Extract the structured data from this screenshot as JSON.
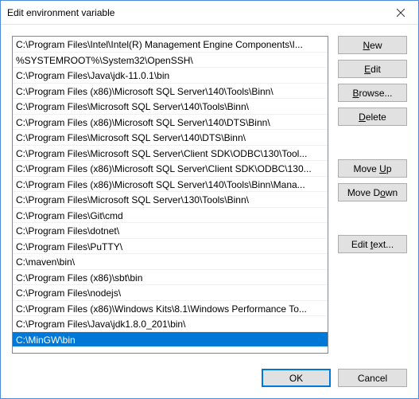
{
  "window": {
    "title": "Edit environment variable"
  },
  "list": {
    "items": [
      "C:\\Program Files\\Intel\\Intel(R) Management Engine Components\\I...",
      "%SYSTEMROOT%\\System32\\OpenSSH\\",
      "C:\\Program Files\\Java\\jdk-11.0.1\\bin",
      "C:\\Program Files (x86)\\Microsoft SQL Server\\140\\Tools\\Binn\\",
      "C:\\Program Files\\Microsoft SQL Server\\140\\Tools\\Binn\\",
      "C:\\Program Files (x86)\\Microsoft SQL Server\\140\\DTS\\Binn\\",
      "C:\\Program Files\\Microsoft SQL Server\\140\\DTS\\Binn\\",
      "C:\\Program Files\\Microsoft SQL Server\\Client SDK\\ODBC\\130\\Tool...",
      "C:\\Program Files (x86)\\Microsoft SQL Server\\Client SDK\\ODBC\\130...",
      "C:\\Program Files (x86)\\Microsoft SQL Server\\140\\Tools\\Binn\\Mana...",
      "C:\\Program Files\\Microsoft SQL Server\\130\\Tools\\Binn\\",
      "C:\\Program Files\\Git\\cmd",
      "C:\\Program Files\\dotnet\\",
      "C:\\Program Files\\PuTTY\\",
      "C:\\maven\\bin\\",
      "C:\\Program Files (x86)\\sbt\\bin",
      "C:\\Program Files\\nodejs\\",
      "C:\\Program Files (x86)\\Windows Kits\\8.1\\Windows Performance To...",
      "C:\\Program Files\\Java\\jdk1.8.0_201\\bin\\",
      "C:\\MinGW\\bin"
    ],
    "selected_index": 19
  },
  "buttons": {
    "new_prefix": "N",
    "new_rest": "ew",
    "edit_prefix": "E",
    "edit_rest": "dit",
    "browse_prefix": "B",
    "browse_rest": "rowse...",
    "delete_prefix": "D",
    "delete_rest": "elete",
    "moveup_prefix": "Move ",
    "moveup_u": "U",
    "moveup_rest": "p",
    "movedown_prefix": "Move D",
    "movedown_u": "o",
    "movedown_rest": "wn",
    "edittext_prefix": "Edit ",
    "edittext_u": "t",
    "edittext_rest": "ext...",
    "ok": "OK",
    "cancel": "Cancel"
  }
}
